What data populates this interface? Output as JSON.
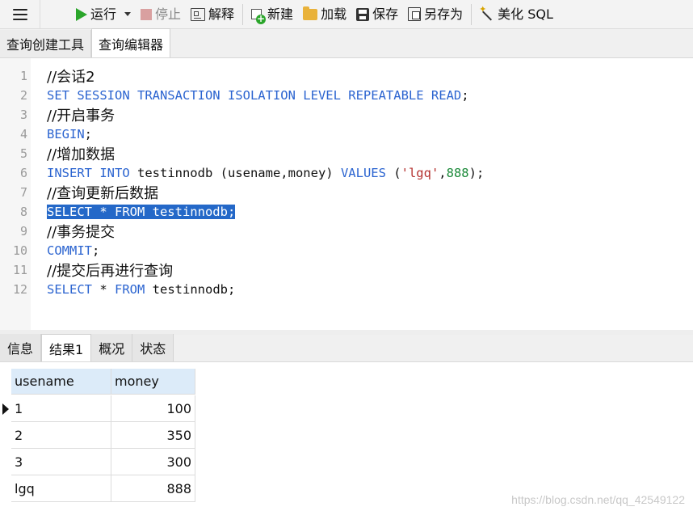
{
  "toolbar": {
    "run_label": "运行",
    "stop_label": "停止",
    "explain_label": "解释",
    "new_label": "新建",
    "load_label": "加载",
    "save_label": "保存",
    "saveas_label": "另存为",
    "beautify_label": "美化 SQL"
  },
  "editor_tabs": [
    {
      "label": "查询创建工具",
      "active": false
    },
    {
      "label": "查询编辑器",
      "active": true
    }
  ],
  "code_lines": [
    {
      "n": "1",
      "comment": "//会话2"
    },
    {
      "n": "2",
      "t": [
        "SET SESSION TRANSACTION ISOLATION LEVEL REPEATABLE READ",
        ";"
      ]
    },
    {
      "n": "3",
      "comment": "//开启事务"
    },
    {
      "n": "4",
      "t": [
        "BEGIN",
        ";"
      ]
    },
    {
      "n": "5",
      "comment": "//增加数据"
    },
    {
      "n": "6",
      "t": [
        "INSERT INTO",
        " testinnodb (usename,money) ",
        "VALUES",
        " (",
        "'lgq'",
        ",",
        "888",
        ");"
      ]
    },
    {
      "n": "7",
      "comment": "//查询更新后数据"
    },
    {
      "n": "8",
      "selected": "SELECT * FROM testinnodb;"
    },
    {
      "n": "9",
      "comment": "//事务提交"
    },
    {
      "n": "10",
      "t": [
        "COMMIT",
        ";"
      ]
    },
    {
      "n": "11",
      "comment": "//提交后再进行查询"
    },
    {
      "n": "12",
      "t": [
        "SELECT",
        " * ",
        "FROM",
        " testinnodb;"
      ]
    }
  ],
  "result_tabs": [
    {
      "label": "信息",
      "active": false
    },
    {
      "label": "结果1",
      "active": true
    },
    {
      "label": "概况",
      "active": false
    },
    {
      "label": "状态",
      "active": false
    }
  ],
  "result": {
    "columns": [
      "usename",
      "money"
    ],
    "rows": [
      [
        "1",
        "100"
      ],
      [
        "2",
        "350"
      ],
      [
        "3",
        "300"
      ],
      [
        "lgq",
        "888"
      ]
    ]
  },
  "watermark": "https://blog.csdn.net/qq_42549122"
}
